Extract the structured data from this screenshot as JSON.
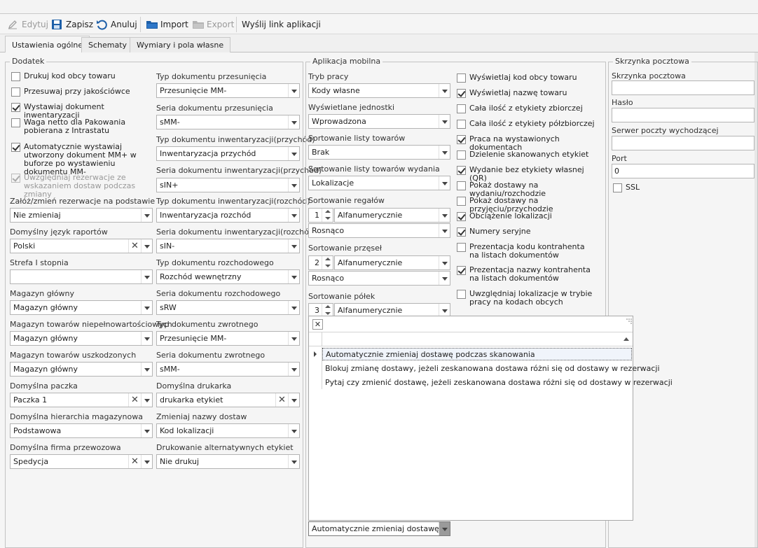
{
  "toolbar": {
    "edit": "Edytuj",
    "save": "Zapisz",
    "cancel": "Anuluj",
    "import": "Import",
    "export": "Export",
    "send_link": "Wyślij link aplikacji"
  },
  "tabs": [
    "Ustawienia ogólne",
    "Schematy",
    "Wymiary i pola własne"
  ],
  "dodatek": {
    "title": "Dodatek",
    "checkboxes": [
      {
        "label": "Drukuj kod obcy towaru",
        "checked": false
      },
      {
        "label": "Przesuwaj przy jakościówce",
        "checked": false
      },
      {
        "label": "Wystawiaj dokument inwentaryzacji",
        "checked": true
      },
      {
        "label": "Waga netto dla Pakowania pobierana z Intrastatu",
        "checked": false
      },
      {
        "label": "Automatycznie wystawiaj utworzony dokument MM+ w buforze po wystawieniu dokumentu MM-",
        "checked": true
      },
      {
        "label": "Uwzględniaj rezerwacje ze wskazaniem dostaw podczas zmiany",
        "checked": true,
        "disabled": true
      }
    ],
    "left_fields": [
      {
        "label": "Załóż/zmień rezerwacje na podstawie",
        "value": "Nie zmieniaj"
      },
      {
        "label": "Domyślny język raportów",
        "value": "Polski"
      },
      {
        "label": "Strefa I stopnia",
        "value": ""
      },
      {
        "label": "Magazyn główny",
        "value": "Magazyn główny"
      },
      {
        "label": "Magazyn towarów niepełnowartościowych",
        "value": "Magazyn główny"
      },
      {
        "label": "Magazyn towarów uszkodzonych",
        "value": "Magazyn główny"
      },
      {
        "label": "Domyślna paczka",
        "value": "Paczka 1"
      },
      {
        "label": "Domyślna hierarchia magazynowa",
        "value": "Podstawowa"
      },
      {
        "label": "Domyślna firma przewozowa",
        "value": "Spedycja"
      }
    ],
    "right_fields": [
      {
        "label": "Typ dokumentu przesunięcia",
        "value": "Przesunięcie MM-"
      },
      {
        "label": "Seria dokumentu przesunięcia",
        "value": "sMM-"
      },
      {
        "label": "Typ dokumentu inwentaryzacji(przychód)",
        "value": "Inwentaryzacja przychód"
      },
      {
        "label": "Seria dokumentu inwentaryzacji(przychód)",
        "value": "sIN+"
      },
      {
        "label": "Typ dokumentu inwentaryzacji(rozchód)",
        "value": "Inwentaryzacja rozchód"
      },
      {
        "label": "Seria dokumentu inwentaryzacji(rozchód)",
        "value": "sIN-"
      },
      {
        "label": "Typ dokumentu rozchodowego",
        "value": "Rozchód wewnętrzny"
      },
      {
        "label": "Seria dokumentu rozchodowego",
        "value": "sRW"
      },
      {
        "label": "Typ dokumentu zwrotnego",
        "value": "Przesunięcie MM-"
      },
      {
        "label": "Seria dokumentu zwrotnego",
        "value": "sMM-"
      },
      {
        "label": "Domyślna drukarka",
        "value": "drukarka etykiet"
      },
      {
        "label": "Zmieniaj nazwy dostaw",
        "value": "Kod lokalizacji"
      },
      {
        "label": "Drukowanie alternatywnych etykiet",
        "value": "Nie drukuj"
      }
    ]
  },
  "mobile": {
    "title": "Aplikacja mobilna",
    "fields": [
      {
        "label": "Tryb pracy",
        "value": "Kody własne"
      },
      {
        "label": "Wyświetlane jednostki",
        "value": "Wprowadzona"
      },
      {
        "label": "Sortowanie listy towarów",
        "value": "Brak"
      },
      {
        "label": "Sortowanie listy towarów wydania",
        "value": "Lokalizacje"
      }
    ],
    "sort_regaly": {
      "label": "Sortowanie regałów",
      "num": "1",
      "type": "Alfanumerycznie",
      "order": "Rosnąco"
    },
    "sort_przesla": {
      "label": "Sortowanie przęseł",
      "num": "2",
      "type": "Alfanumerycznie",
      "order": "Rosnąco"
    },
    "sort_polki": {
      "label": "Sortowanie półek",
      "num": "3",
      "type": "Alfanumerycznie"
    },
    "bottom_combo": "Automatycznie zmieniaj dostawę po...",
    "checkboxes": [
      {
        "label": "Wyświetlaj kod obcy towaru",
        "checked": false
      },
      {
        "label": "Wyświetlaj nazwę towaru",
        "checked": true
      },
      {
        "label": "Cała ilość z etykiety zbiorczej",
        "checked": false
      },
      {
        "label": "Cała ilość z etykiety półzbiorczej",
        "checked": false
      },
      {
        "label": "Praca na wystawionych dokumentach",
        "checked": true
      },
      {
        "label": "Dzielenie skanowanych etykiet",
        "checked": false
      },
      {
        "label": "Wydanie bez etykiety własnej (QR)",
        "checked": true
      },
      {
        "label": "Pokaż dostawy na wydaniu/rozchodzie",
        "checked": false
      },
      {
        "label": "Pokaż dostawy na przyjęciu/przychodzie",
        "checked": false
      },
      {
        "label": "Obciążenie lokalizacji",
        "checked": true
      },
      {
        "label": "Numery seryjne",
        "checked": true
      },
      {
        "label": "Prezentacja kodu kontrahenta na listach dokumentów",
        "checked": false
      },
      {
        "label": "Prezentacja nazwy kontrahenta na listach dokumentów",
        "checked": true
      },
      {
        "label": "Uwzględniaj lokalizacje w trybie pracy na kodach obcych",
        "checked": false
      }
    ]
  },
  "popup": {
    "close_symbol": "✕",
    "rows": [
      "Automatycznie zmieniaj dostawę podczas skanowania",
      "Blokuj zmianę dostawy, jeżeli zeskanowana dostawa różni się od dostawy w rezerwacji",
      "Pytaj czy zmienić dostawę, jeżeli zeskanowana dostawa różni się od dostawy w rezerwacji"
    ]
  },
  "mailbox": {
    "title": "Skrzynka pocztowa",
    "fields": [
      {
        "label": "Skrzynka pocztowa",
        "value": ""
      },
      {
        "label": "Hasło",
        "value": ""
      },
      {
        "label": "Serwer poczty wychodzącej",
        "value": ""
      },
      {
        "label": "Port",
        "value": "0"
      }
    ],
    "ssl_label": "SSL",
    "ssl_checked": false
  },
  "icons": {
    "edit": "pencil-icon",
    "save": "floppy-disk-icon",
    "cancel": "undo-arrow-icon",
    "import": "folder-icon",
    "export": "folder-icon"
  }
}
